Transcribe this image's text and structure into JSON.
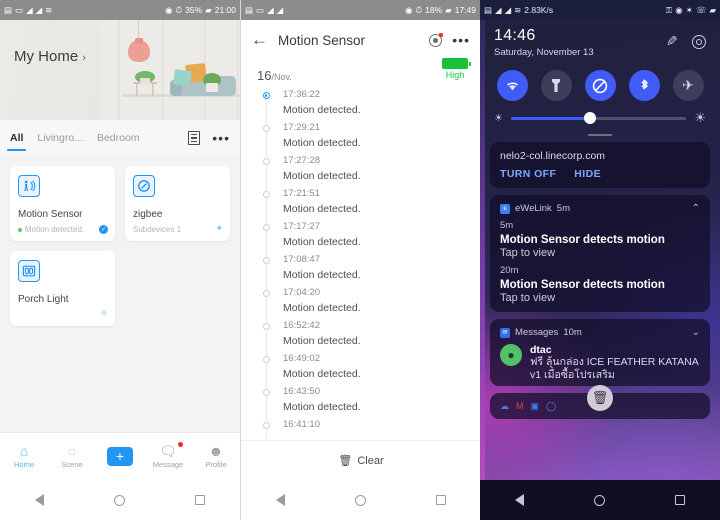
{
  "panel1": {
    "statusbar": {
      "time": "21:00",
      "battery": "35%",
      "icons": [
        "sim",
        "usb",
        "signal",
        "signal2",
        "wifi",
        "eye",
        "alarm",
        "battery"
      ]
    },
    "home_title": "My Home",
    "home_chevron": "›",
    "tabs": [
      {
        "label": "All",
        "active": true
      },
      {
        "label": "Livingro...",
        "active": false
      },
      {
        "label": "Bedroom",
        "active": false
      }
    ],
    "tab_icons": [
      "list-icon",
      "more-icon"
    ],
    "cards": [
      {
        "name": "Motion Sensor",
        "sub": "Motion detected.",
        "status_dot": true,
        "icon": "motion-sensor-icon",
        "badge": "check"
      },
      {
        "name": "zigbee",
        "sub": "Subdevices 1",
        "status_dot": false,
        "icon": "zigbee-bridge-icon",
        "badge": "zigbee"
      },
      {
        "name": "Porch Light",
        "sub": "",
        "status_dot": false,
        "icon": "switch-icon",
        "badge": "zigbee"
      }
    ],
    "tabbar": [
      {
        "label": "Home",
        "icon": "home-icon",
        "active": true
      },
      {
        "label": "Scene",
        "icon": "scene-icon",
        "active": false
      },
      {
        "label": "",
        "icon": "plus-icon",
        "active": false
      },
      {
        "label": "Message",
        "icon": "message-icon",
        "active": false,
        "badge": true
      },
      {
        "label": "Profile",
        "icon": "profile-icon",
        "active": false
      }
    ]
  },
  "panel2": {
    "statusbar": {
      "time": "17:49",
      "battery": "18%"
    },
    "back_icon": "back-arrow-icon",
    "title": "Motion Sensor",
    "header_icons": [
      "camera-icon",
      "more-icon"
    ],
    "battery_label": "High",
    "date_day": "16",
    "date_month": "/Nov.",
    "log": [
      {
        "time": "17:36:22",
        "msg": "Motion detected."
      },
      {
        "time": "17:29:21",
        "msg": "Motion detected."
      },
      {
        "time": "17:27:28",
        "msg": "Motion detected."
      },
      {
        "time": "17:21:51",
        "msg": "Motion detected."
      },
      {
        "time": "17:17:27",
        "msg": "Motion detected."
      },
      {
        "time": "17:08:47",
        "msg": "Motion detected."
      },
      {
        "time": "17:04:20",
        "msg": "Motion detected."
      },
      {
        "time": "16:52:42",
        "msg": "Motion detected."
      },
      {
        "time": "16:49:02",
        "msg": "Motion detected."
      },
      {
        "time": "16:43:50",
        "msg": "Motion detected."
      },
      {
        "time": "16:41:10",
        "msg": ""
      }
    ],
    "clear_label": "Clear",
    "clear_icon": "trash-icon"
  },
  "panel3": {
    "statusbar": {
      "speed": "2.83K/s"
    },
    "clock": "14:46",
    "date": "Saturday, November 13",
    "edit_icon": "pencil-icon",
    "settings_icon": "gear-icon",
    "quick_settings": [
      {
        "name": "wifi-icon",
        "glyph": "⌃",
        "on": true
      },
      {
        "name": "flashlight-icon",
        "glyph": "",
        "on": false
      },
      {
        "name": "do-not-disturb-icon",
        "glyph": "⊘",
        "on": true
      },
      {
        "name": "bluetooth-icon",
        "glyph": "",
        "on": true
      },
      {
        "name": "airplane-mode-icon",
        "glyph": "✈",
        "on": false
      }
    ],
    "brightness_percent": 45,
    "notifications": [
      {
        "type": "url",
        "url": "nelo2-col.linecorp.com",
        "buttons": [
          "TURN OFF",
          "HIDE"
        ]
      },
      {
        "type": "app",
        "app": "eWeLink",
        "app_time": "5m",
        "items": [
          {
            "time": "5m",
            "title": "Motion Sensor detects motion",
            "body": "Tap to view"
          },
          {
            "time": "20m",
            "title": "Motion Sensor detects motion",
            "body": "Tap to view"
          }
        ]
      },
      {
        "type": "messages",
        "app": "Messages",
        "app_time": "10m",
        "sender": "dtac",
        "text": "ฟรี ลุ้นกล่อง ICE FEATHER KATANA v1 เมื่อซื้อโปรเสริม"
      }
    ],
    "tray_icons": [
      "cloud-icon",
      "gmail-icon",
      "app-icon",
      "sync-icon"
    ],
    "clear_all_icon": "trash-icon"
  },
  "navbar": {
    "back": "back-icon",
    "home": "home-icon",
    "recents": "recents-icon"
  }
}
